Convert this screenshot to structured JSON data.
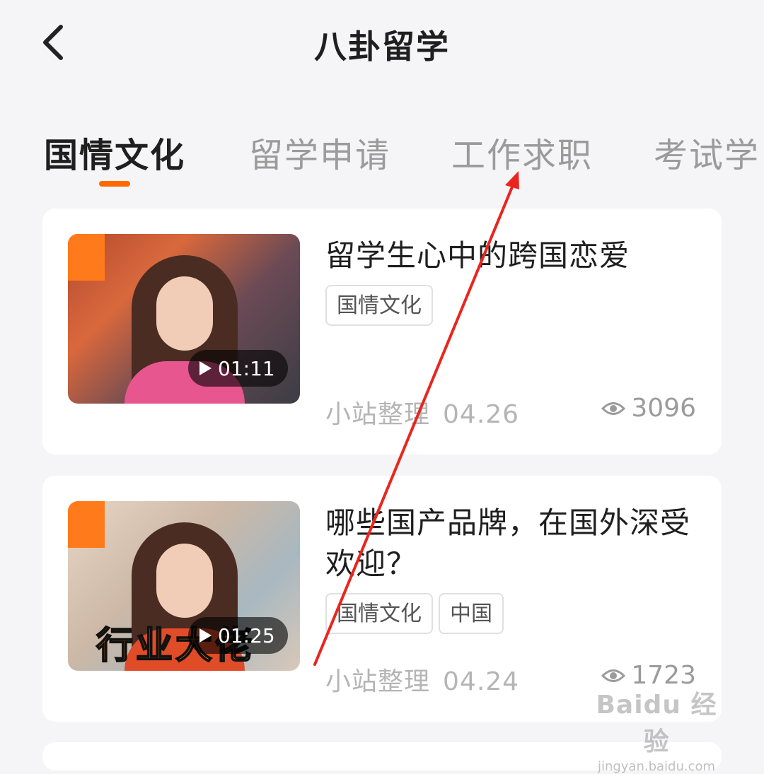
{
  "header": {
    "title": "八卦留学",
    "back_icon": "chevron-left-icon"
  },
  "tabs": [
    {
      "label": "国情文化",
      "active": true
    },
    {
      "label": "留学申请",
      "active": false
    },
    {
      "label": "工作求职",
      "active": false
    },
    {
      "label": "考试学",
      "active": false
    }
  ],
  "accent_color": "#ff6a00",
  "cards": [
    {
      "title": "留学生心中的跨国恋爱",
      "duration": "01:11",
      "tags": [
        "国情文化"
      ],
      "author": "小站整理",
      "date": "04.26",
      "views": "3096"
    },
    {
      "title": "哪些国产品牌，在国外深受欢迎？",
      "duration": "01:25",
      "thumb_caption": "行业大佬",
      "tags": [
        "国情文化",
        "中国"
      ],
      "author": "小站整理",
      "date": "04.24",
      "views": "1723"
    }
  ],
  "watermark": {
    "line1": "Baidu 经验",
    "line2": "jingyan.baidu.com"
  }
}
